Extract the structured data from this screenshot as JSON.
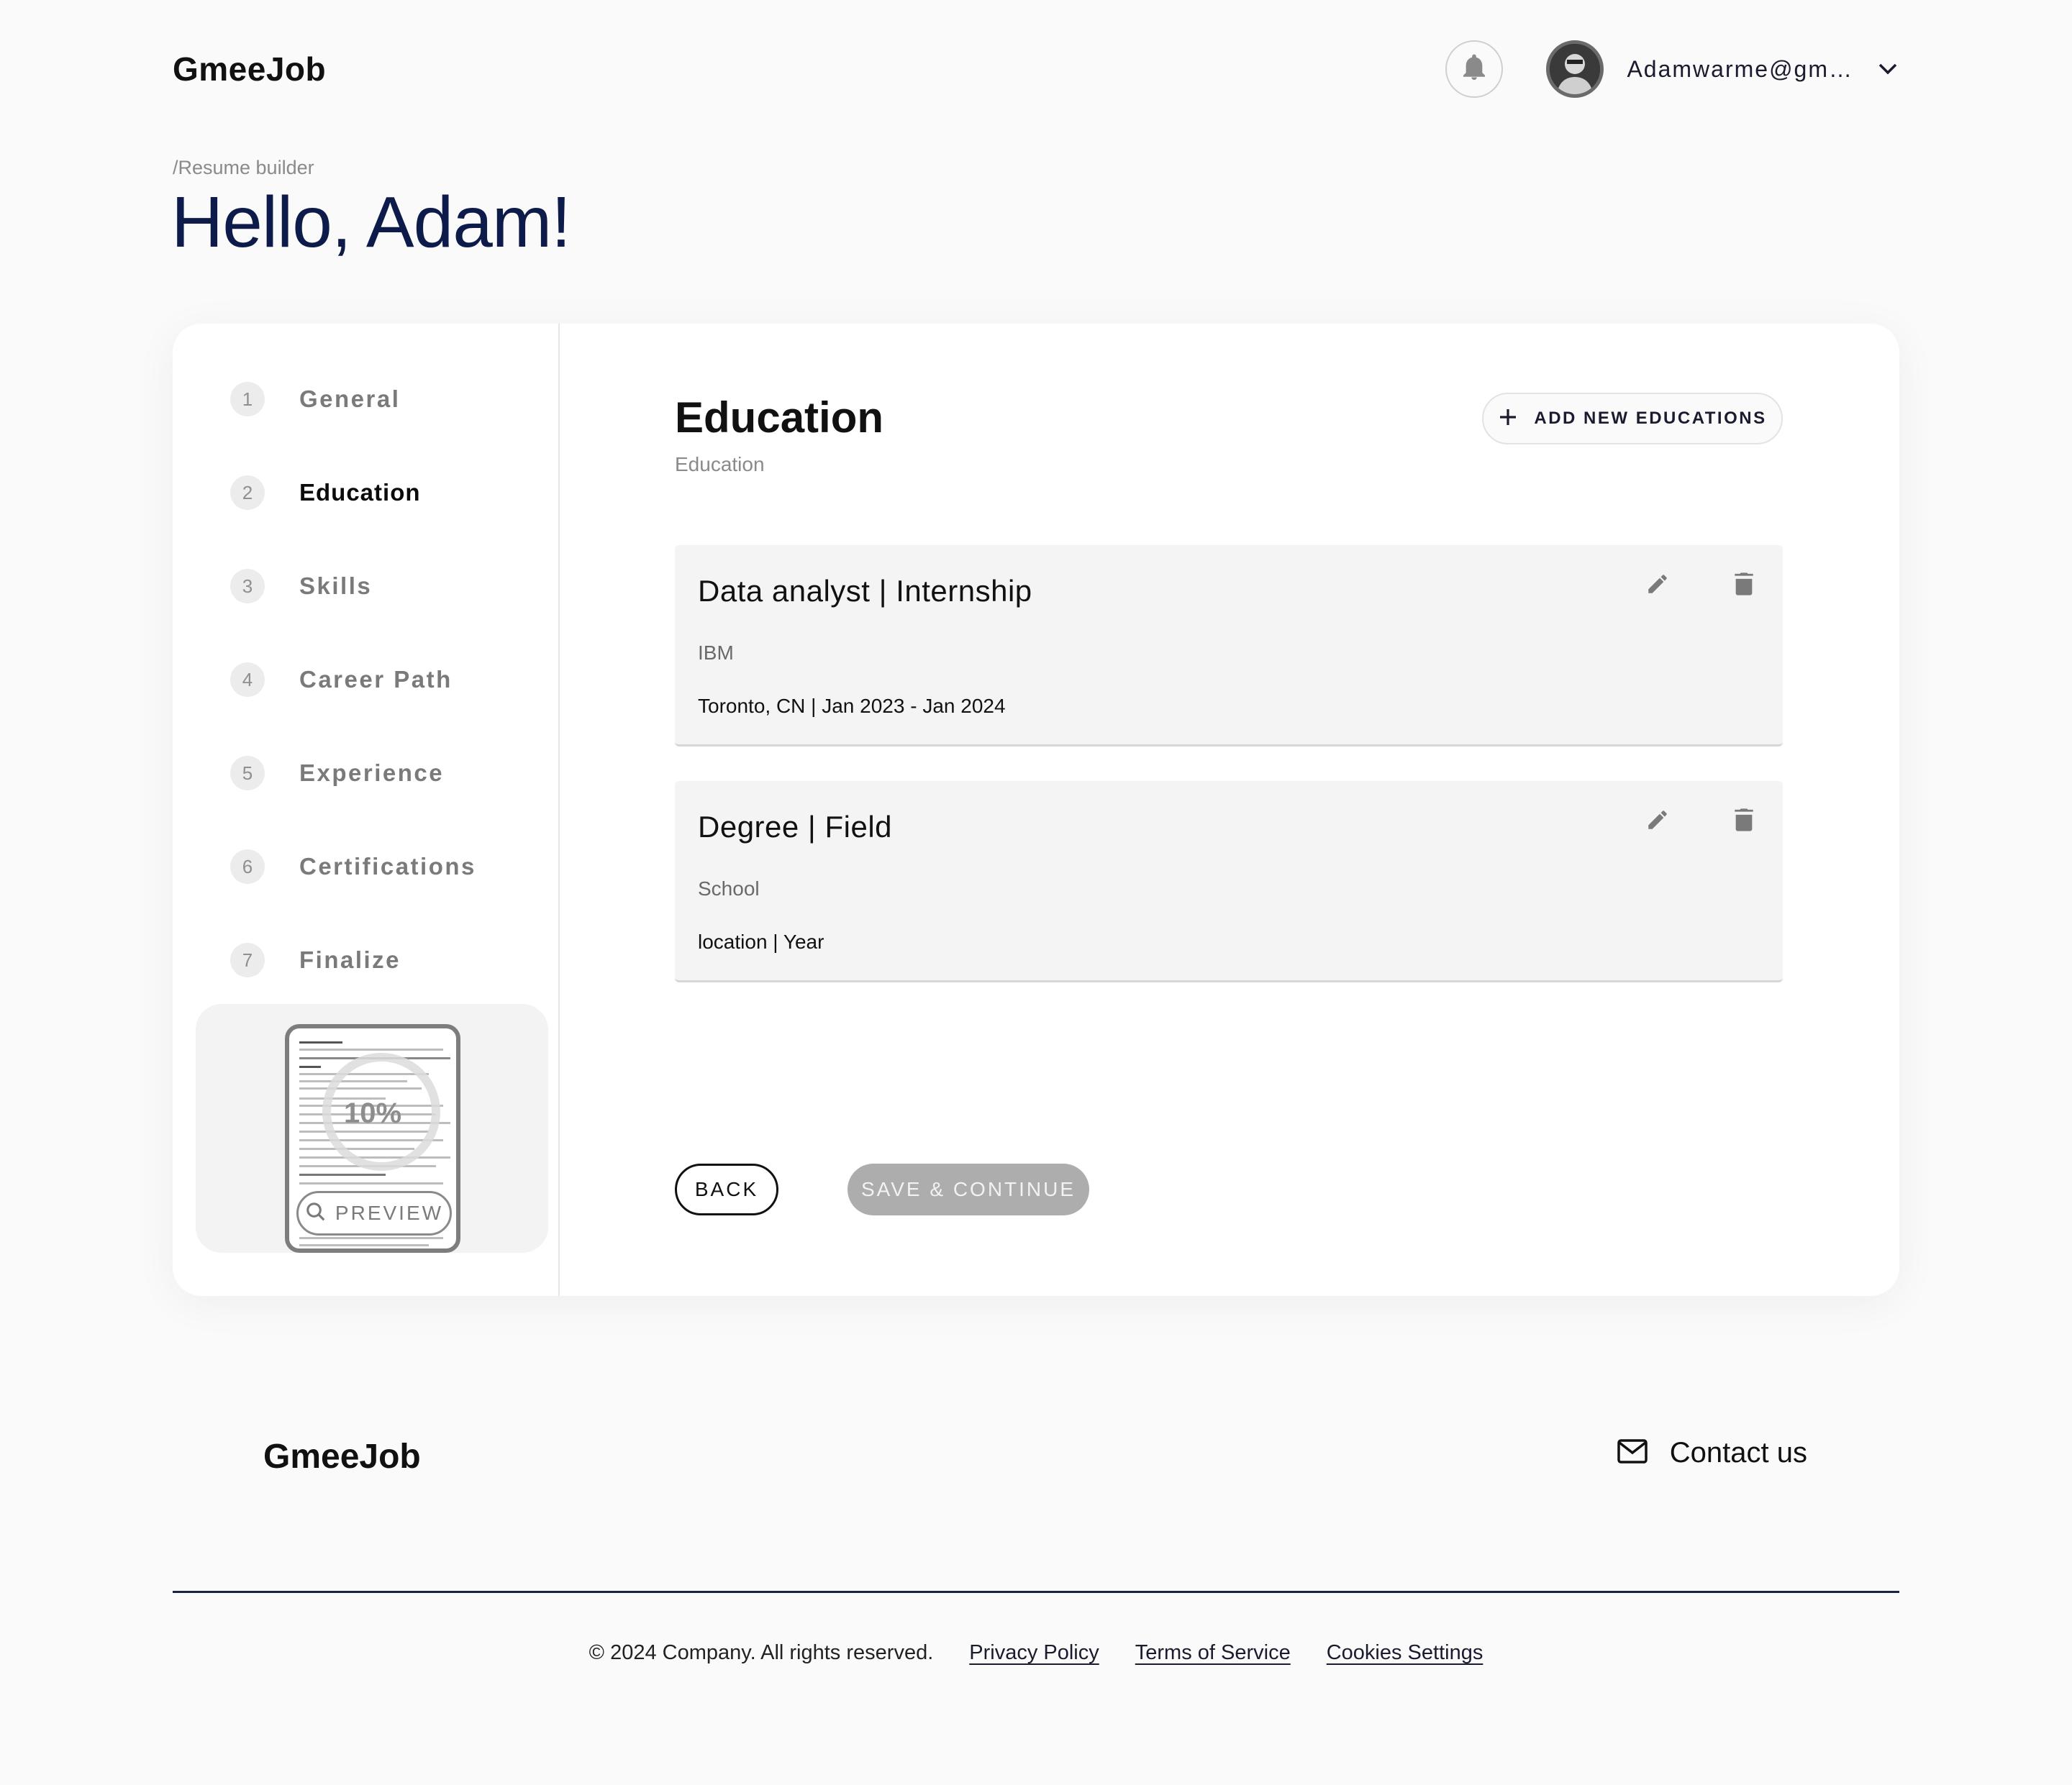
{
  "header": {
    "logo": "GmeeJob",
    "user_email": "Adamwarme@gm…",
    "icons": {
      "notifications": "bell-icon",
      "menu": "chevron-down-icon"
    }
  },
  "page": {
    "breadcrumb": "/Resume builder",
    "greeting": "Hello, Adam!"
  },
  "sidebar": {
    "steps": [
      {
        "number": "1",
        "label": "General"
      },
      {
        "number": "2",
        "label": "Education",
        "active": true
      },
      {
        "number": "3",
        "label": "Skills"
      },
      {
        "number": "4",
        "label": "Career Path"
      },
      {
        "number": "5",
        "label": "Experience"
      },
      {
        "number": "6",
        "label": "Certifications"
      },
      {
        "number": "7",
        "label": "Finalize"
      }
    ],
    "preview": {
      "progress_text": "10%",
      "progress": 0.1,
      "button_label": "PREVIEW"
    }
  },
  "section": {
    "title": "Education",
    "subtitle": "Education",
    "add_button": "ADD NEW EDUCATIONS",
    "entries": [
      {
        "title": "Data analyst | Internship",
        "org": "IBM",
        "meta": "Toronto, CN | Jan 2023 - Jan 2024"
      },
      {
        "title": "Degree | Field",
        "org": "School",
        "meta": "location | Year"
      }
    ],
    "back_button": "BACK",
    "save_button": "SAVE & CONTINUE"
  },
  "footer": {
    "logo": "GmeeJob",
    "contact": "Contact us",
    "copyright": "© 2024 Company. All rights reserved.",
    "links": [
      "Privacy Policy",
      "Terms of Service",
      "Cookies Settings"
    ]
  },
  "colors": {
    "heading": "#0d1b4a",
    "disabled_button": "#adadad",
    "divider": "#1b2340"
  }
}
